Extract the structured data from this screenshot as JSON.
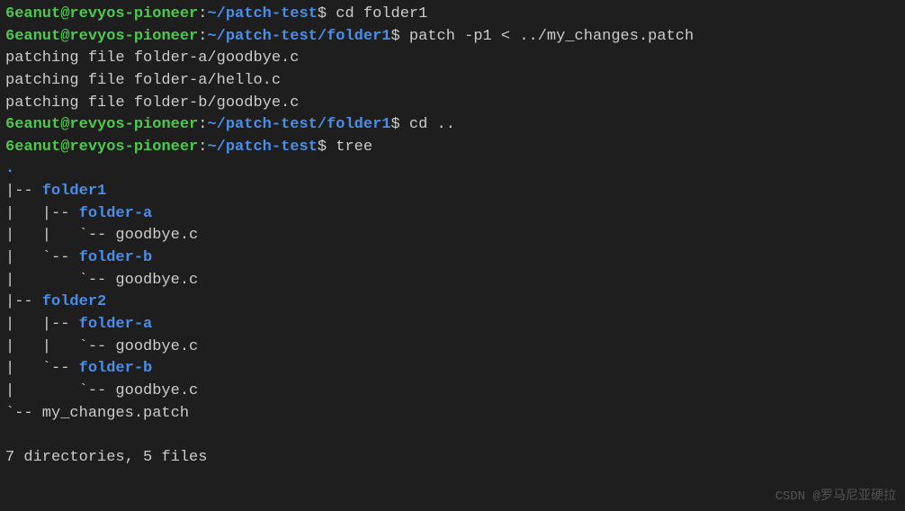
{
  "prompt1": {
    "user": "6eanut",
    "host": "revyos-pioneer",
    "path": "~/patch-test",
    "cmd": "cd folder1"
  },
  "prompt2": {
    "user": "6eanut",
    "host": "revyos-pioneer",
    "path": "~/patch-test/folder1",
    "cmd": "patch -p1 < ../my_changes.patch"
  },
  "patch_out1": "patching file folder-a/goodbye.c",
  "patch_out2": "patching file folder-a/hello.c",
  "patch_out3": "patching file folder-b/goodbye.c",
  "prompt3": {
    "user": "6eanut",
    "host": "revyos-pioneer",
    "path": "~/patch-test/folder1",
    "cmd": "cd .."
  },
  "prompt4": {
    "user": "6eanut",
    "host": "revyos-pioneer",
    "path": "~/patch-test",
    "cmd": "tree"
  },
  "tree": {
    "root": ".",
    "l0a": "|-- ",
    "l0a_name": "folder1",
    "l1a": "|   |-- ",
    "l1a_name": "folder-a",
    "l2a": "|   |   `-- goodbye.c",
    "l1b": "|   `-- ",
    "l1b_name": "folder-b",
    "l2b": "|       `-- goodbye.c",
    "l0b": "|-- ",
    "l0b_name": "folder2",
    "l1c": "|   |-- ",
    "l1c_name": "folder-a",
    "l2c": "|   |   `-- goodbye.c",
    "l1d": "|   `-- ",
    "l1d_name": "folder-b",
    "l2d": "|       `-- goodbye.c",
    "l0c": "`-- my_changes.patch",
    "summary": "7 directories, 5 files"
  },
  "watermark": "CSDN @罗马尼亚硬拉"
}
